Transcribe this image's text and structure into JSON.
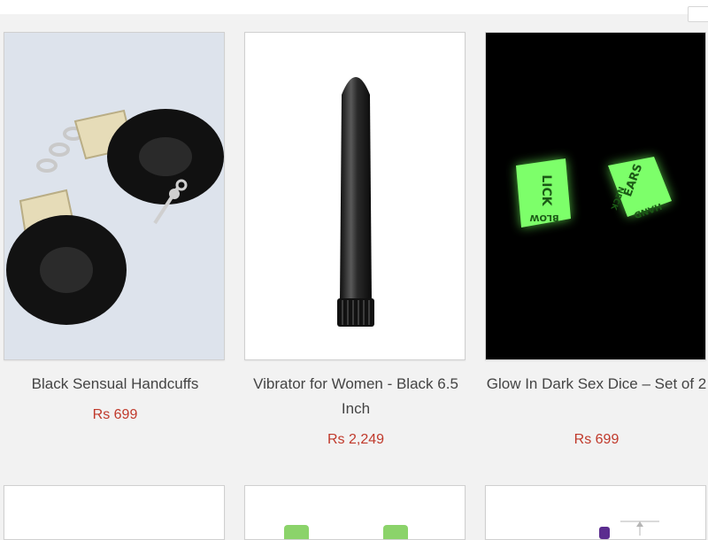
{
  "products": [
    {
      "name": "Black Sensual Handcuffs",
      "price": "Rs 699",
      "image_icon": "handcuffs-image"
    },
    {
      "name": "Vibrator for Women - Black 6.5 Inch",
      "price": "Rs 2,249",
      "image_icon": "vibrator-image"
    },
    {
      "name": "Glow In Dark Sex Dice – Set of 2",
      "price": "Rs 699",
      "image_icon": "dice-image",
      "dice_words": [
        "LICK",
        "BLOW",
        "EARS",
        "HAND",
        "NECK"
      ]
    }
  ],
  "colors": {
    "price": "#c0392b",
    "title": "#444444",
    "glow": "#6dff5a"
  }
}
